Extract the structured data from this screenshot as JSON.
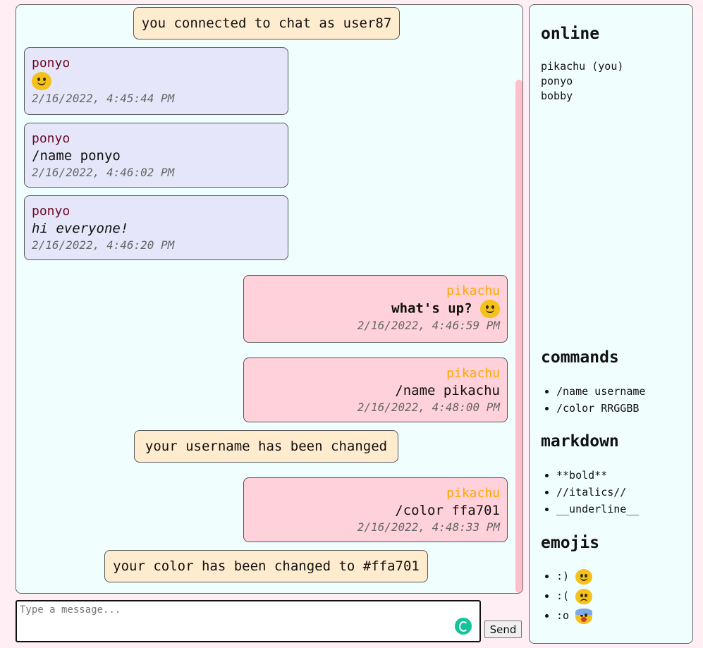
{
  "chat": {
    "notice_connected": "you connected to chat as user87",
    "messages": [
      {
        "user": "ponyo",
        "text": "",
        "time": "2/16/2022, 4:45:44 PM"
      },
      {
        "user": "ponyo",
        "text": "/name ponyo",
        "time": "2/16/2022, 4:46:02 PM"
      },
      {
        "user": "ponyo",
        "text": "hi everyone!",
        "time": "2/16/2022, 4:46:20 PM"
      },
      {
        "user": "pikachu",
        "text": "what's up?",
        "time": "2/16/2022, 4:46:59 PM"
      },
      {
        "user": "pikachu",
        "text": "/name pikachu",
        "time": "2/16/2022, 4:48:00 PM"
      },
      {
        "user": "pikachu",
        "text": "/color ffa701",
        "time": "2/16/2022, 4:48:33 PM"
      }
    ],
    "notice_username": "your username has been changed",
    "notice_color": "your color has been changed to #ffa701"
  },
  "sidebar": {
    "online_title": "online",
    "online_users": [
      "pikachu (you)",
      "ponyo",
      "bobby"
    ],
    "commands_title": "commands",
    "commands": [
      "/name username",
      "/color RRGGBB"
    ],
    "markdown_title": "markdown",
    "markdown": [
      "**bold**",
      "//italics//",
      "__underline__"
    ],
    "emojis_title": "emojis",
    "emojis": [
      {
        "code": ":)",
        "icon": "smile-emoji"
      },
      {
        "code": ":(",
        "icon": "frown-emoji"
      },
      {
        "code": ":o",
        "icon": "shocked-emoji"
      }
    ]
  },
  "composer": {
    "placeholder": "Type a message...",
    "send_label": "Send"
  },
  "colors": {
    "own_user": "#ffa701",
    "other_user": "#6b0b26",
    "own_bubble": "#ffd1da",
    "other_bubble": "#e6e6fa",
    "notice_bubble": "#ffebcd",
    "panel_bg": "#f0fffe",
    "page_bg": "#ffeef3"
  }
}
